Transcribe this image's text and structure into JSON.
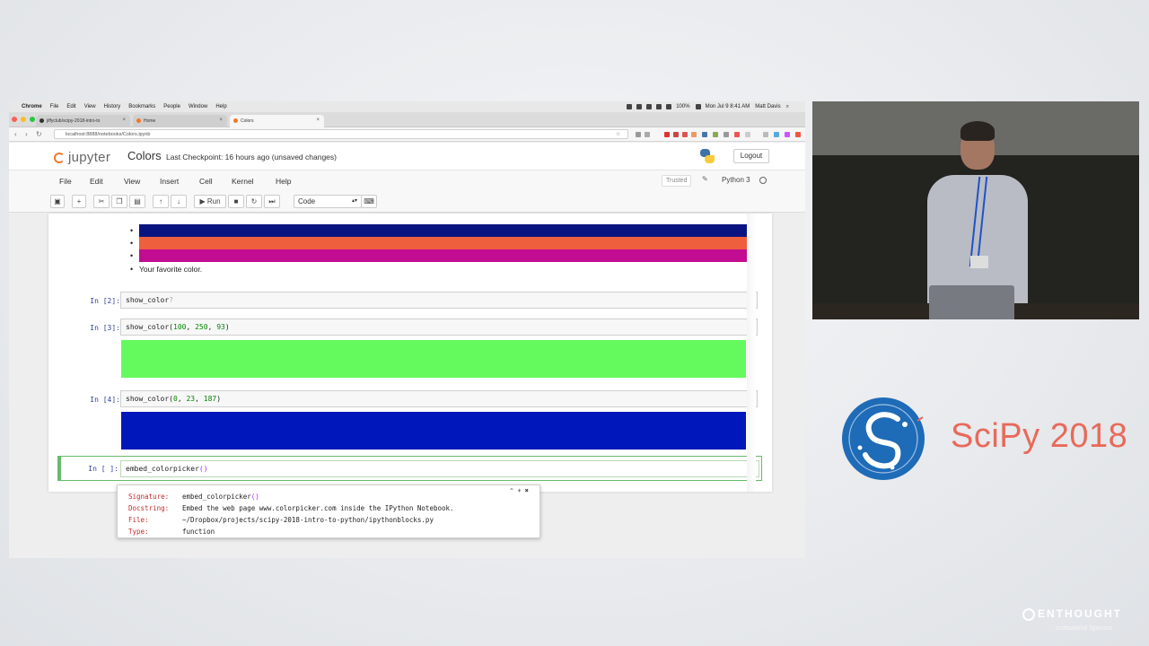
{
  "mac_menubar": {
    "app": "Chrome",
    "items": [
      "File",
      "Edit",
      "View",
      "History",
      "Bookmarks",
      "People",
      "Window",
      "Help"
    ],
    "battery": "100%",
    "clock": "Mon Jul 9 8:41 AM",
    "user": "Matt Davis"
  },
  "browser": {
    "tabs": [
      {
        "label": "jiffyclub/scipy-2018-intro-to",
        "active": false
      },
      {
        "label": "Home",
        "active": false
      },
      {
        "label": "Colors",
        "active": true
      }
    ],
    "url": "localhost:8888/notebooks/Colors.ipynb"
  },
  "jupyter": {
    "logo_text": "jupyter",
    "notebook_name": "Colors",
    "checkpoint": "Last Checkpoint: 16 hours ago",
    "unsaved": "(unsaved changes)",
    "logout": "Logout",
    "menu": [
      "File",
      "Edit",
      "View",
      "Insert",
      "Cell",
      "Kernel",
      "Help"
    ],
    "trusted": "Trusted",
    "kernel": "Python 3",
    "toolbar": {
      "run": "Run",
      "cell_type": "Code"
    }
  },
  "notebook": {
    "bullet_bars": [
      {
        "color": "#0a1480"
      },
      {
        "color": "#ee5f3d"
      },
      {
        "color": "#c20c91"
      }
    ],
    "favorite_text": "Your favorite color.",
    "cells": [
      {
        "prompt": "In [2]:",
        "fn": "show_color",
        "args": "",
        "suffix": "?"
      },
      {
        "prompt": "In [3]:",
        "fn": "show_color",
        "args_prefix": "(",
        "a1": "100",
        "a2": "250",
        "a3": "93",
        "output_color": "#64fa5d"
      },
      {
        "prompt": "In [4]:",
        "fn": "show_color",
        "args_prefix": "(",
        "a1": "0",
        "a2": "23",
        "a3": "187",
        "output_color": "#0017bb"
      }
    ],
    "active_cell": {
      "prompt": "In [ ]:",
      "code": "embed_colorpicker",
      "paren": "()"
    },
    "tooltip": {
      "signature_key": "Signature:",
      "signature_val": "embed_colorpicker",
      "signature_paren": "()",
      "docstring_key": "Docstring:",
      "docstring_val": "Embed the web page www.colorpicker.com inside the IPython Notebook.",
      "file_key": "File:",
      "file_val": "~/Dropbox/projects/scipy-2018-intro-to-python/ipythonblocks.py",
      "type_key": "Type:",
      "type_val": "function"
    }
  },
  "branding": {
    "conference": "SciPy 2018",
    "sponsor": "ENTHOUGHT",
    "sponsor_sub": "Institutional Sponsor"
  },
  "colors": {
    "accent_orange": "#f37726",
    "scipy_red": "#e86a5a",
    "scipy_blue": "#1e6bb8",
    "prompt_blue": "#303f9f",
    "select_green": "#66bb6a"
  }
}
